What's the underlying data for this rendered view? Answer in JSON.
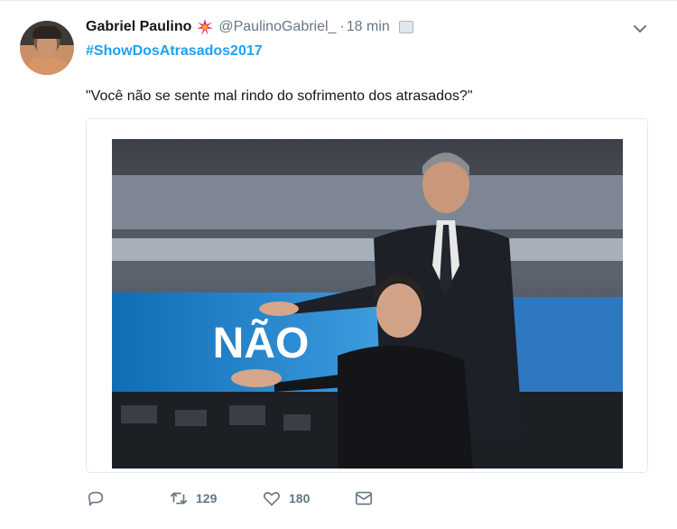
{
  "tweet": {
    "display_name": "Gabriel Paulino",
    "badge_icon": "sparkle-icon",
    "handle": "@PaulinoGabriel_",
    "separator": "·",
    "time": "18 min",
    "hashtag": "#ShowDosAtrasados2017",
    "text": "\"Você não se sente mal rindo do sofrimento dos atrasados?\"",
    "media": {
      "overlay_text": "NÃO"
    },
    "actions": {
      "reply_icon": "reply-icon",
      "retweet_icon": "retweet-icon",
      "retweet_count": "129",
      "like_icon": "heart-icon",
      "like_count": "180",
      "dm_icon": "envelope-icon"
    }
  },
  "colors": {
    "link": "#1da1f2",
    "muted": "#657786",
    "badge": "#e0245e"
  }
}
